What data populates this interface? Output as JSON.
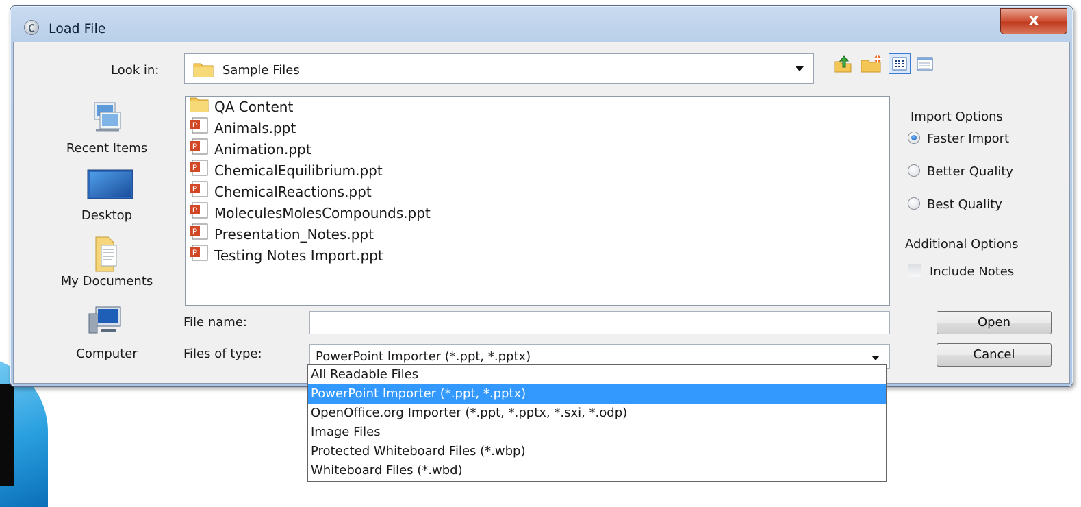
{
  "window": {
    "title": "Load File",
    "close_label": "x"
  },
  "lookin": {
    "label": "Look in:",
    "value": "Sample Files"
  },
  "toolbar": {
    "icons": [
      "up-one-level-icon",
      "create-new-folder-icon",
      "list-view-icon",
      "details-view-icon"
    ]
  },
  "places": [
    {
      "label": "Recent Items",
      "icon": "recent-items-icon"
    },
    {
      "label": "Desktop",
      "icon": "desktop-icon"
    },
    {
      "label": "My Documents",
      "icon": "my-documents-icon"
    },
    {
      "label": "Computer",
      "icon": "computer-icon"
    }
  ],
  "files": [
    {
      "name": "QA Content",
      "icon": "folder-icon"
    },
    {
      "name": "Animals.ppt",
      "icon": "ppt-file-icon"
    },
    {
      "name": "Animation.ppt",
      "icon": "ppt-file-icon"
    },
    {
      "name": "ChemicalEquilibrium.ppt",
      "icon": "ppt-file-icon"
    },
    {
      "name": "ChemicalReactions.ppt",
      "icon": "ppt-file-icon"
    },
    {
      "name": "MoleculesMolesCompounds.ppt",
      "icon": "ppt-file-icon"
    },
    {
      "name": "Presentation_Notes.ppt",
      "icon": "ppt-file-icon"
    },
    {
      "name": "Testing Notes Import.ppt",
      "icon": "ppt-file-icon"
    }
  ],
  "import_options": {
    "heading": "Import Options",
    "options": [
      {
        "label": "Faster Import",
        "selected": true
      },
      {
        "label": "Better Quality",
        "selected": false
      },
      {
        "label": "Best Quality",
        "selected": false
      }
    ]
  },
  "additional_options": {
    "heading": "Additional Options",
    "include_notes_label": "Include Notes",
    "include_notes_checked": false
  },
  "filename": {
    "label": "File name:",
    "value": ""
  },
  "filetype": {
    "label": "Files of type:",
    "value": "PowerPoint Importer (*.ppt, *.pptx)",
    "options": [
      {
        "label": "All Readable Files",
        "selected": false
      },
      {
        "label": "PowerPoint Importer (*.ppt, *.pptx)",
        "selected": true
      },
      {
        "label": "OpenOffice.org Importer (*.ppt, *.pptx, *.sxi, *.odp)",
        "selected": false
      },
      {
        "label": "Image Files",
        "selected": false
      },
      {
        "label": "Protected Whiteboard Files (*.wbp)",
        "selected": false
      },
      {
        "label": "Whiteboard Files (*.wbd)",
        "selected": false
      }
    ]
  },
  "buttons": {
    "open": "Open",
    "cancel": "Cancel"
  },
  "colors": {
    "selection": "#3399ff",
    "titlebar": "#b7cde8",
    "close": "#c03a1e"
  }
}
